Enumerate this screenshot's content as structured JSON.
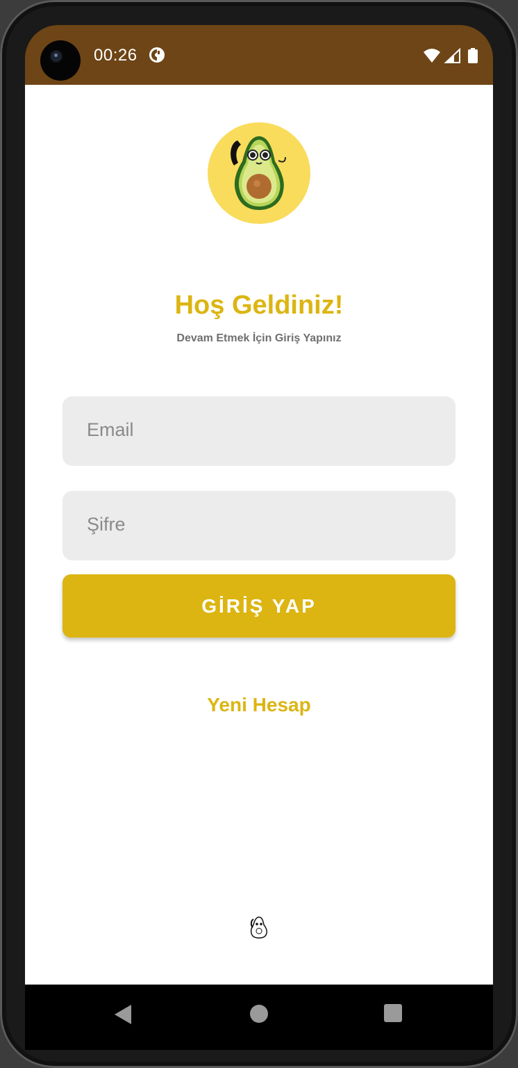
{
  "status_bar": {
    "time": "00:26",
    "background_color": "#6e4516",
    "icons": [
      "data-saver-icon",
      "wifi-icon",
      "signal-icon",
      "battery-icon"
    ]
  },
  "login": {
    "title": "Hoş Geldiniz!",
    "subtitle": "Devam Etmek İçin Giriş Yapınız",
    "email_placeholder": "Email",
    "password_placeholder": "Şifre",
    "login_button": "GİRİŞ YAP",
    "signup_link": "Yeni Hesap",
    "accent_color": "#dcb512"
  },
  "branding": {
    "logo": "avocado-phone-logo-icon",
    "footer_logo": "avocado-mini-logo-icon"
  },
  "nav_bar": {
    "icons": [
      "back-icon",
      "home-icon",
      "recents-icon"
    ]
  }
}
